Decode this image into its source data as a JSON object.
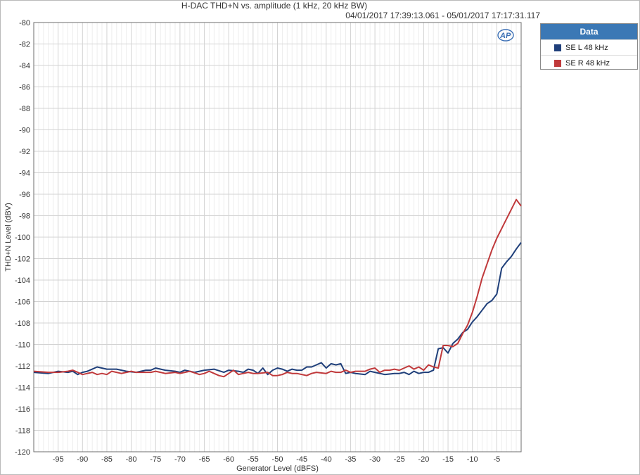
{
  "chart_data": {
    "type": "line",
    "title": "H-DAC THD+N vs. amplitude (1 kHz, 20 kHz BW)",
    "subtitle": "04/01/2017 17:39:13.061 - 05/01/2017 17:17:31.117",
    "xlabel": "Generator Level (dBFS)",
    "ylabel": "THD+N Level (dBV)",
    "xlim": [
      -100,
      0
    ],
    "ylim": [
      -120,
      -80
    ],
    "x_ticks": [
      -95,
      -90,
      -85,
      -80,
      -75,
      -70,
      -65,
      -60,
      -55,
      -50,
      -45,
      -40,
      -35,
      -30,
      -25,
      -20,
      -15,
      -10,
      -5
    ],
    "y_ticks": [
      -80,
      -82,
      -84,
      -86,
      -88,
      -90,
      -92,
      -94,
      -96,
      -98,
      -100,
      -102,
      -104,
      -106,
      -108,
      -110,
      -112,
      -114,
      -116,
      -118,
      -120
    ],
    "grid": true,
    "legend": {
      "title": "Data",
      "position": "right"
    },
    "series": [
      {
        "name": "SE L 48 kHz",
        "color": "#1f3f7a",
        "x": [
          -100,
          -97,
          -95,
          -93,
          -92,
          -91,
          -90,
          -89,
          -87,
          -85,
          -83,
          -81,
          -79,
          -77,
          -76,
          -75,
          -73,
          -71,
          -70,
          -69,
          -67,
          -66,
          -65,
          -63,
          -61,
          -60,
          -58,
          -57,
          -56,
          -55,
          -54,
          -53,
          -52,
          -51,
          -50,
          -49,
          -48,
          -47,
          -46,
          -45,
          -44,
          -43,
          -42,
          -41,
          -40,
          -39,
          -38,
          -37,
          -36,
          -35,
          -34,
          -32,
          -31,
          -30,
          -28,
          -26,
          -25,
          -24,
          -23,
          -22,
          -21,
          -20,
          -19,
          -18,
          -17,
          -16,
          -15,
          -14,
          -13,
          -12,
          -11,
          -10,
          -9,
          -8,
          -7,
          -6,
          -5,
          -4,
          -3,
          -2,
          -1,
          0
        ],
        "y": [
          -112.6,
          -112.7,
          -112.5,
          -112.6,
          -112.5,
          -112.8,
          -112.6,
          -112.5,
          -112.1,
          -112.3,
          -112.3,
          -112.5,
          -112.6,
          -112.4,
          -112.4,
          -112.2,
          -112.4,
          -112.5,
          -112.6,
          -112.4,
          -112.6,
          -112.5,
          -112.4,
          -112.3,
          -112.6,
          -112.4,
          -112.5,
          -112.6,
          -112.3,
          -112.4,
          -112.7,
          -112.2,
          -112.8,
          -112.4,
          -112.2,
          -112.3,
          -112.5,
          -112.3,
          -112.4,
          -112.4,
          -112.1,
          -112.1,
          -111.9,
          -111.7,
          -112.2,
          -111.8,
          -111.9,
          -111.8,
          -112.7,
          -112.6,
          -112.7,
          -112.8,
          -112.5,
          -112.6,
          -112.8,
          -112.7,
          -112.7,
          -112.6,
          -112.8,
          -112.5,
          -112.7,
          -112.6,
          -112.6,
          -112.4,
          -110.4,
          -110.3,
          -110.8,
          -109.9,
          -109.5,
          -108.9,
          -108.6,
          -107.9,
          -107.4,
          -106.8,
          -106.2,
          -105.9,
          -105.3,
          -102.9,
          -102.3,
          -101.8,
          -101.1,
          -100.5
        ]
      },
      {
        "name": "SE R 48 kHz",
        "color": "#c0393b",
        "x": [
          -100,
          -97,
          -95,
          -93,
          -92,
          -91,
          -90,
          -89,
          -88,
          -87,
          -86,
          -85,
          -84,
          -82,
          -81,
          -80,
          -79,
          -77,
          -76,
          -75,
          -74,
          -73,
          -71,
          -70,
          -69,
          -68,
          -66,
          -65,
          -64,
          -63,
          -62,
          -61,
          -60,
          -59,
          -58,
          -57,
          -56,
          -55,
          -54,
          -52,
          -51,
          -50,
          -49,
          -48,
          -47,
          -46,
          -44,
          -43,
          -42,
          -40,
          -39,
          -38,
          -37,
          -36,
          -35,
          -34,
          -32,
          -31,
          -30,
          -29,
          -28,
          -27,
          -26,
          -25,
          -24,
          -23,
          -22,
          -21,
          -20,
          -19,
          -18,
          -17,
          -16,
          -15,
          -14,
          -13,
          -12,
          -11,
          -10,
          -9,
          -8,
          -7,
          -6,
          -5,
          -4,
          -3,
          -2,
          -1,
          0
        ],
        "y": [
          -112.5,
          -112.6,
          -112.6,
          -112.5,
          -112.4,
          -112.6,
          -112.8,
          -112.7,
          -112.6,
          -112.8,
          -112.7,
          -112.8,
          -112.5,
          -112.7,
          -112.6,
          -112.5,
          -112.6,
          -112.6,
          -112.6,
          -112.5,
          -112.6,
          -112.7,
          -112.6,
          -112.7,
          -112.6,
          -112.5,
          -112.8,
          -112.7,
          -112.5,
          -112.7,
          -112.9,
          -113.0,
          -112.7,
          -112.4,
          -112.8,
          -112.7,
          -112.6,
          -112.7,
          -112.7,
          -112.6,
          -112.9,
          -112.9,
          -112.8,
          -112.6,
          -112.7,
          -112.7,
          -112.9,
          -112.7,
          -112.6,
          -112.7,
          -112.5,
          -112.6,
          -112.6,
          -112.4,
          -112.6,
          -112.5,
          -112.5,
          -112.3,
          -112.2,
          -112.6,
          -112.4,
          -112.4,
          -112.3,
          -112.4,
          -112.2,
          -112.0,
          -112.3,
          -112.1,
          -112.4,
          -111.9,
          -112.1,
          -112.2,
          -110.1,
          -110.1,
          -110.2,
          -109.9,
          -109.0,
          -108.2,
          -107.0,
          -105.5,
          -103.8,
          -102.5,
          -101.2,
          -100.1,
          -99.2,
          -98.3,
          -97.4,
          -96.5,
          -97.1
        ]
      }
    ]
  }
}
